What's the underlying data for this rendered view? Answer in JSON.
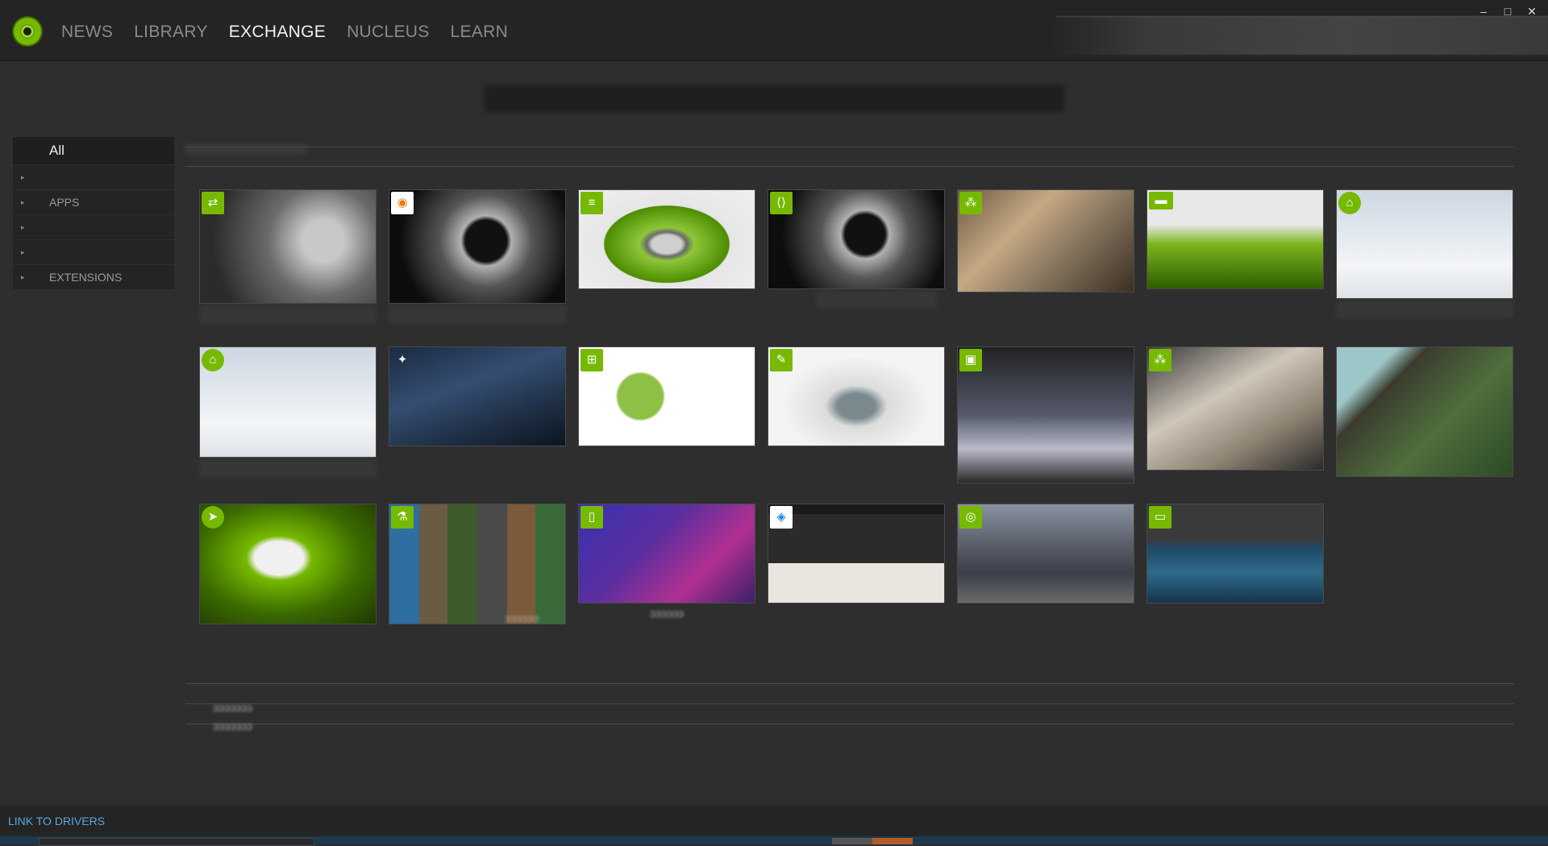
{
  "nav": {
    "items": [
      "NEWS",
      "LIBRARY",
      "EXCHANGE",
      "NUCLEUS",
      "LEARN"
    ],
    "active": "EXCHANGE"
  },
  "window_controls": [
    "–",
    "□",
    "✕"
  ],
  "user_strip_text": "RuΩ θααυχσ",
  "sidebar": {
    "items": [
      {
        "label": "All",
        "expandable": false
      },
      {
        "label": "",
        "expandable": true
      },
      {
        "label": "APPS",
        "expandable": true
      },
      {
        "label": "",
        "expandable": true
      },
      {
        "label": "",
        "expandable": true
      },
      {
        "label": "EXTENSIONS",
        "expandable": true
      }
    ]
  },
  "grid": {
    "cards": [
      {
        "icon": "connector-icon",
        "thumb": "t-grey"
      },
      {
        "icon": "blender-icon",
        "thumb": "t-dark"
      },
      {
        "icon": "database-icon",
        "thumb": "t-greenstack"
      },
      {
        "icon": "code-icon",
        "thumb": "t-dark"
      },
      {
        "icon": "nodes-icon",
        "thumb": "t-kitchen"
      },
      {
        "icon": "server-icon",
        "thumb": "t-green"
      },
      {
        "icon": "home-icon",
        "thumb": "t-server"
      },
      {
        "icon": "home-icon",
        "thumb": "t-server"
      },
      {
        "icon": "robot-arm-icon",
        "thumb": "t-robot"
      },
      {
        "icon": "bear-icon",
        "thumb": "t-topiary"
      },
      {
        "icon": "ai-icon",
        "thumb": "t-white"
      },
      {
        "icon": "clapper-icon",
        "thumb": "t-astro"
      },
      {
        "icon": "nodes-icon",
        "thumb": "t-desk"
      },
      {
        "icon": "",
        "thumb": "t-mine"
      },
      {
        "icon": "paper-plane-icon",
        "thumb": "t-jet"
      },
      {
        "icon": "flask-icon",
        "thumb": "t-collage"
      },
      {
        "icon": "doc-icon",
        "thumb": "t-purple"
      },
      {
        "icon": "cube-icon",
        "thumb": "t-ui"
      },
      {
        "icon": "globe-icon",
        "thumb": "t-city"
      },
      {
        "icon": "vr-icon",
        "thumb": "t-pool"
      }
    ]
  },
  "captions": {
    "card2": "ɔɔɔɔɔ ɔɔɔɔɔɔ",
    "card15": "ɔɔɔɔɔɔ",
    "card16": "ɔɔɔɔɔɔ",
    "bottom1": "ɔɔɔɔɔɔɔ",
    "bottom2": "ɔɔɔɔɔɔɔ"
  },
  "footer": {
    "link_to_drivers": "LINK TO DRIVERS"
  }
}
